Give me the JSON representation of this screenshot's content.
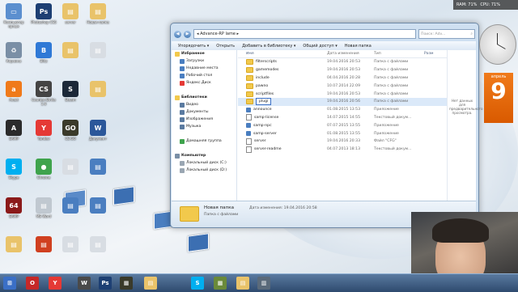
{
  "overlay": {
    "ram": "RAM: 71%",
    "cpu": "CPU: 71%"
  },
  "desktop_icons": [
    {
      "label": "Компьютер ярлык",
      "glyph": "▭",
      "color": "#5b8fcf"
    },
    {
      "label": "Photoshop CS5",
      "glyph": "Ps",
      "color": "#1d3f73"
    },
    {
      "label": "server",
      "glyph": "▤",
      "color": "#e9c36a"
    },
    {
      "label": "Новая папка",
      "glyph": "▤",
      "color": "#e9c36a"
    },
    {
      "label": "Корзина",
      "glyph": "♻",
      "color": "#7a8fa6"
    },
    {
      "label": "Blitz",
      "glyph": "B",
      "color": "#2f79d6"
    },
    {
      "label": "",
      "glyph": "▤",
      "color": "#e9c36a"
    },
    {
      "label": "",
      "glyph": "▤",
      "color": "#d8dde3"
    },
    {
      "label": "Avast",
      "glyph": "a",
      "color": "#f07a1a"
    },
    {
      "label": "Counter-Strike 1.6",
      "glyph": "CS",
      "color": "#444"
    },
    {
      "label": "Steam",
      "glyph": "S",
      "color": "#1b2838"
    },
    {
      "label": "",
      "glyph": "▤",
      "color": "#e9c36a"
    },
    {
      "label": "SAMP",
      "glyph": "A",
      "color": "#2b2b2b"
    },
    {
      "label": "Yandex",
      "glyph": "Y",
      "color": "#e53935"
    },
    {
      "label": "CS:GO",
      "glyph": "GO",
      "color": "#3a3a2a"
    },
    {
      "label": "Документ",
      "glyph": "W",
      "color": "#2b579a"
    },
    {
      "label": "Skype",
      "glyph": "S",
      "color": "#00aff0"
    },
    {
      "label": "Chrome",
      "glyph": "●",
      "color": "#3fa34d"
    },
    {
      "label": "",
      "glyph": "▤",
      "color": "#d8dde3"
    },
    {
      "label": "",
      "glyph": "▤",
      "color": "#4a7ec0"
    },
    {
      "label": "SAMP",
      "glyph": "64",
      "color": "#8b1a1a"
    },
    {
      "label": "MS Word",
      "glyph": "▤",
      "color": "#c0c8d0"
    },
    {
      "label": "",
      "glyph": "▤",
      "color": "#4a7ec0"
    },
    {
      "label": "",
      "glyph": "▤",
      "color": "#4a7ec0"
    },
    {
      "label": "",
      "glyph": "▤",
      "color": "#e9c36a"
    },
    {
      "label": "",
      "glyph": "▤",
      "color": "#d04020"
    },
    {
      "label": "",
      "glyph": "▤",
      "color": "#d8dde3"
    },
    {
      "label": "",
      "glyph": "▤",
      "color": "#d8dde3"
    }
  ],
  "explorer": {
    "address": "◂ Advance-RP lame ▸",
    "search_placeholder": "Поиск: Adv...",
    "toolbar": [
      "Упорядочить ▾",
      "Открыть",
      "Добавить в библиотеку ▾",
      "Общий доступ ▾",
      "Новая папка"
    ],
    "nav": [
      {
        "label": "Избранное",
        "icon": "#f2c94c",
        "bold": true
      },
      {
        "label": "Загрузки",
        "icon": "#4a7ec0"
      },
      {
        "label": "Недавние места",
        "icon": "#4a7ec0"
      },
      {
        "label": "Рабочий стол",
        "icon": "#4a7ec0"
      },
      {
        "label": "Яндекс.Диск",
        "icon": "#e53935"
      },
      {
        "label": "",
        "icon": ""
      },
      {
        "label": "Библиотеки",
        "icon": "#f2c94c",
        "bold": true
      },
      {
        "label": "Видео",
        "icon": "#5a7aa0"
      },
      {
        "label": "Документы",
        "icon": "#5a7aa0"
      },
      {
        "label": "Изображения",
        "icon": "#5a7aa0"
      },
      {
        "label": "Музыка",
        "icon": "#5a7aa0"
      },
      {
        "label": "",
        "icon": ""
      },
      {
        "label": "Домашняя группа",
        "icon": "#3fa34d"
      },
      {
        "label": "",
        "icon": ""
      },
      {
        "label": "Компьютер",
        "icon": "#7a8fa6",
        "bold": true
      },
      {
        "label": "Локальный диск (C:)",
        "icon": "#9aa6b2"
      },
      {
        "label": "Локальный диск (D:)",
        "icon": "#9aa6b2"
      }
    ],
    "columns": {
      "name": "Имя",
      "date": "Дата изменения",
      "type": "Тип",
      "size": "Разм"
    },
    "files": [
      {
        "name": "filterscripts",
        "date": "19.04.2016 20:53",
        "type": "Папка с файлами",
        "kind": "folder"
      },
      {
        "name": "gamemodes",
        "date": "19.04.2016 20:53",
        "type": "Папка с файлами",
        "kind": "folder"
      },
      {
        "name": "include",
        "date": "04.04.2016 20:28",
        "type": "Папка с файлами",
        "kind": "folder"
      },
      {
        "name": "pawno",
        "date": "10.07.2014 22:09",
        "type": "Папка с файлами",
        "kind": "folder"
      },
      {
        "name": "scriptfiles",
        "date": "19.04.2016 20:53",
        "type": "Папка с файлами",
        "kind": "folder"
      },
      {
        "name": "plugi",
        "date": "19.04.2016 20:56",
        "type": "Папка с файлами",
        "kind": "folder",
        "renaming": true
      },
      {
        "name": "announce",
        "date": "01.08.2015 13:53",
        "type": "Приложение",
        "kind": "exe"
      },
      {
        "name": "samp-license",
        "date": "14.07.2015 14:55",
        "type": "Текстовый докум...",
        "kind": "file"
      },
      {
        "name": "samp-npc",
        "date": "07.07.2015 13:55",
        "type": "Приложение",
        "kind": "exe"
      },
      {
        "name": "samp-server",
        "date": "01.08.2015 13:55",
        "type": "Приложение",
        "kind": "exe"
      },
      {
        "name": "server",
        "date": "19.04.2016 20:33",
        "type": "Файл \"CFG\"",
        "kind": "file"
      },
      {
        "name": "server-readme",
        "date": "04.07.2013 18:13",
        "type": "Текстовый докум...",
        "kind": "file"
      }
    ],
    "preview_text": "Нет данных для предварительного просмотра.",
    "status": {
      "name": "Новая папка",
      "date_label": "Дата изменения: 19.04.2016 20:58",
      "type": "Папка с файлами"
    }
  },
  "calendar": {
    "month": "апрель",
    "day": "9"
  },
  "taskbar": [
    {
      "glyph": "⊞",
      "color": "#3a6fc6"
    },
    {
      "glyph": "O",
      "color": "#c62828"
    },
    {
      "glyph": "Y",
      "color": "#e53935"
    },
    {
      "glyph": "W",
      "color": "#4a4a4a"
    },
    {
      "glyph": "Ps",
      "color": "#1d3f73"
    },
    {
      "glyph": "▦",
      "color": "#3a3a2a"
    },
    {
      "glyph": "▤",
      "color": "#e9c36a"
    },
    {
      "glyph": "S",
      "color": "#00aff0"
    },
    {
      "glyph": "▦",
      "color": "#6a8a3a"
    },
    {
      "glyph": "▤",
      "color": "#e9c36a"
    },
    {
      "glyph": "▥",
      "color": "#5a6a7a"
    }
  ]
}
